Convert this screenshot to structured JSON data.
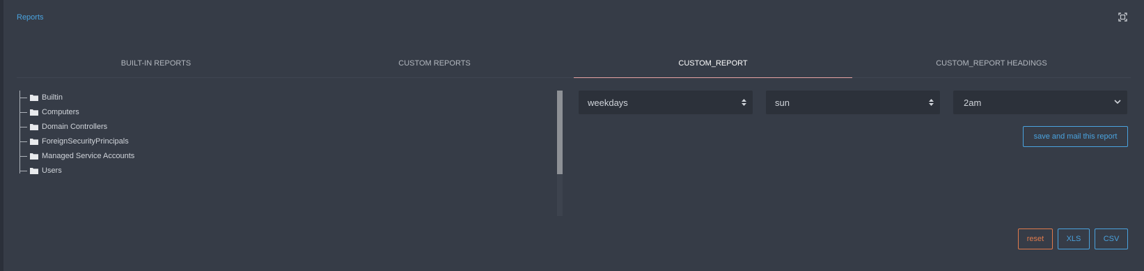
{
  "breadcrumb": "Reports",
  "tabs": [
    "BUILT-IN REPORTS",
    "CUSTOM REPORTS",
    "CUSTOM_REPORT",
    "CUSTOM_REPORT HEADINGS"
  ],
  "active_tab": "CUSTOM_REPORT",
  "tree": [
    "Builtin",
    "Computers",
    "Domain Controllers",
    "ForeignSecurityPrincipals",
    "Managed Service Accounts",
    "Users"
  ],
  "schedule": {
    "frequency": "weekdays",
    "day": "sun",
    "time": "2am"
  },
  "buttons": {
    "save_mail": "save and mail this report",
    "reset": "reset",
    "xls": "XLS",
    "csv": "CSV"
  },
  "colors": {
    "link": "#4aa3df",
    "warn": "#e07b4c",
    "tab_underline": "#e8a3a3"
  },
  "icons": [
    "expand-icon",
    "folder-icon",
    "select-arrow-icon",
    "chevron-down-icon"
  ]
}
